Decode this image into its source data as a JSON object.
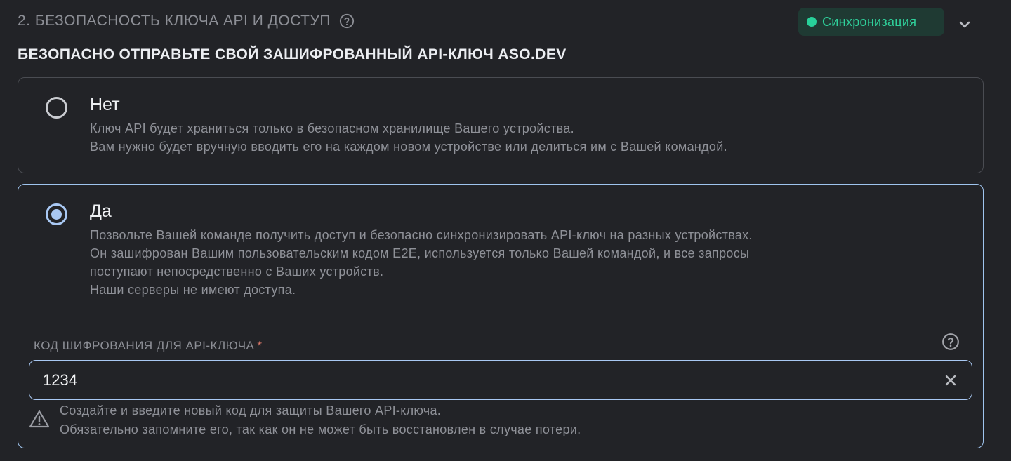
{
  "section": {
    "title": "2. БЕЗОПАСНОСТЬ КЛЮЧА API И ДОСТУП",
    "help_icon": "question-circle-icon",
    "sync_badge": "Синхронизация",
    "sync_color": "#28d19a",
    "expand_icon": "chevron-down-icon"
  },
  "subtitle": "БЕЗОПАСНО ОТПРАВЬТЕ СВОЙ ЗАШИФРОВАННЫЙ API-КЛЮЧ ASO.DEV",
  "options": [
    {
      "title": "Нет",
      "selected": false,
      "description": [
        "Ключ API будет храниться только в безопасном хранилище Вашего устройства.",
        "Вам нужно будет вручную вводить его на каждом новом устройстве или делиться им с Вашей командой."
      ]
    },
    {
      "title": "Да",
      "selected": true,
      "description": [
        "Позвольте Вашей команде получить доступ и безопасно синхронизировать API-ключ на разных устройствах.",
        "Он зашифрован Вашим пользовательским кодом E2E, используется только Вашей командой, и все запросы",
        "поступают непосредственно с Ваших устройств.",
        "Наши серверы не имеют доступа."
      ]
    }
  ],
  "encryption": {
    "label": "КОД ШИФРОВАНИЯ ДЛЯ API-КЛЮЧА",
    "required_mark": "*",
    "value": "1234",
    "help_icon": "question-circle-icon",
    "clear_icon": "close-icon",
    "warning_icon": "warning-triangle-icon",
    "warning": [
      "Создайте и введите новый код для защиты Вашего API-ключа.",
      "Обязательно запомните его, так как он не может быть восстановлен в случае потери."
    ]
  },
  "colors": {
    "accent": "#a9c8f3",
    "sync_bg": "#1f3a33",
    "required": "#e07a6a"
  }
}
